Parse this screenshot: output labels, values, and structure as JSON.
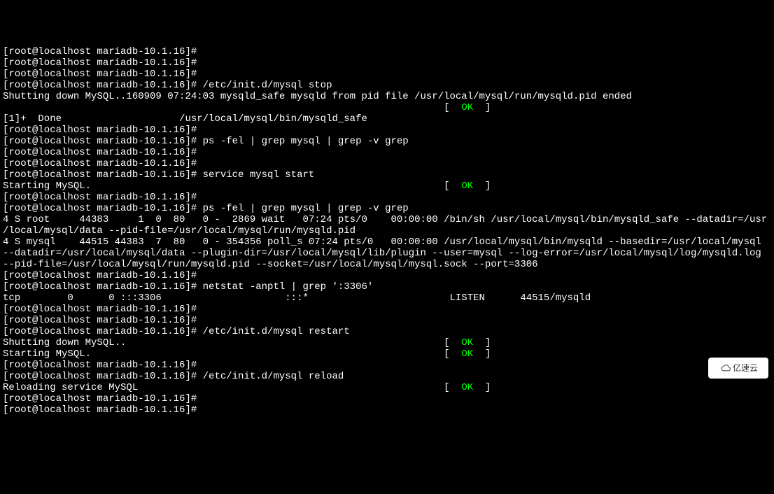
{
  "prompt": "[root@localhost mariadb-10.1.16]#",
  "lines": [
    {
      "t": "prompt",
      "cmd": ""
    },
    {
      "t": "prompt",
      "cmd": ""
    },
    {
      "t": "prompt",
      "cmd": ""
    },
    {
      "t": "prompt",
      "cmd": " /etc/init.d/mysql stop"
    },
    {
      "t": "text",
      "content": "Shutting down MySQL..160909 07:24:03 mysqld_safe mysqld from pid file /usr/local/mysql/run/mysqld.pid ended"
    },
    {
      "t": "status",
      "prefix": "                                                                           [  ",
      "status": "OK",
      "suffix": "  ]"
    },
    {
      "t": "text",
      "content": "[1]+  Done                    /usr/local/mysql/bin/mysqld_safe"
    },
    {
      "t": "prompt",
      "cmd": ""
    },
    {
      "t": "prompt",
      "cmd": " ps -fel | grep mysql | grep -v grep"
    },
    {
      "t": "prompt",
      "cmd": ""
    },
    {
      "t": "prompt",
      "cmd": ""
    },
    {
      "t": "prompt",
      "cmd": " service mysql start"
    },
    {
      "t": "status",
      "prefix": "Starting MySQL.                                                            [  ",
      "status": "OK",
      "suffix": "  ]"
    },
    {
      "t": "prompt",
      "cmd": ""
    },
    {
      "t": "prompt",
      "cmd": " ps -fel | grep mysql | grep -v grep"
    },
    {
      "t": "text",
      "content": "4 S root     44383     1  0  80   0 -  2869 wait   07:24 pts/0    00:00:00 /bin/sh /usr/local/mysql/bin/mysqld_safe --datadir=/usr/local/mysql/data --pid-file=/usr/local/mysql/run/mysqld.pid"
    },
    {
      "t": "text",
      "content": "4 S mysql    44515 44383  7  80   0 - 354356 poll_s 07:24 pts/0   00:00:00 /usr/local/mysql/bin/mysqld --basedir=/usr/local/mysql --datadir=/usr/local/mysql/data --plugin-dir=/usr/local/mysql/lib/plugin --user=mysql --log-error=/usr/local/mysql/log/mysqld.log --pid-file=/usr/local/mysql/run/mysqld.pid --socket=/usr/local/mysql/mysql.sock --port=3306"
    },
    {
      "t": "prompt",
      "cmd": ""
    },
    {
      "t": "prompt",
      "cmd": " netstat -anptl | grep ':3306'"
    },
    {
      "t": "text",
      "content": "tcp        0      0 :::3306                     :::*                        LISTEN      44515/mysqld"
    },
    {
      "t": "prompt",
      "cmd": ""
    },
    {
      "t": "prompt",
      "cmd": ""
    },
    {
      "t": "prompt",
      "cmd": " /etc/init.d/mysql restart"
    },
    {
      "t": "status",
      "prefix": "Shutting down MySQL..                                                      [  ",
      "status": "OK",
      "suffix": "  ]"
    },
    {
      "t": "status",
      "prefix": "Starting MySQL.                                                            [  ",
      "status": "OK",
      "suffix": "  ]"
    },
    {
      "t": "prompt",
      "cmd": ""
    },
    {
      "t": "prompt",
      "cmd": " /etc/init.d/mysql reload"
    },
    {
      "t": "status",
      "prefix": "Reloading service MySQL                                                    [  ",
      "status": "OK",
      "suffix": "  ]"
    },
    {
      "t": "prompt",
      "cmd": ""
    },
    {
      "t": "prompt",
      "cmd": ""
    }
  ],
  "watermark": "亿速云"
}
